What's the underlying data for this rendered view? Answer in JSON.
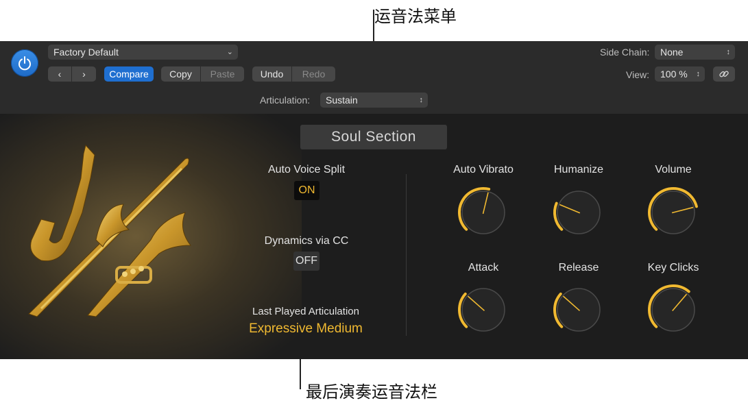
{
  "callouts": {
    "top": "运音法菜单",
    "bottom": "最后演奏运音法栏"
  },
  "header": {
    "preset": "Factory Default",
    "compare": "Compare",
    "copy": "Copy",
    "paste": "Paste",
    "undo": "Undo",
    "redo": "Redo",
    "articulation_label": "Articulation:",
    "articulation_value": "Sustain",
    "side_chain_label": "Side Chain:",
    "side_chain_value": "None",
    "view_label": "View:",
    "view_value": "100 %"
  },
  "plugin": {
    "title": "Soul Section",
    "auto_voice_split": {
      "label": "Auto Voice Split",
      "value": "ON"
    },
    "dynamics_via_cc": {
      "label": "Dynamics via CC",
      "value": "OFF"
    },
    "last_played": {
      "label": "Last Played Articulation",
      "value": "Expressive Medium"
    },
    "knobs": [
      {
        "label": "Auto Vibrato",
        "value": 0.55
      },
      {
        "label": "Humanize",
        "value": 0.25
      },
      {
        "label": "Volume",
        "value": 0.78
      },
      {
        "label": "Attack",
        "value": 0.32
      },
      {
        "label": "Release",
        "value": 0.32
      },
      {
        "label": "Key Clicks",
        "value": 0.65
      }
    ]
  },
  "colors": {
    "accent": "#f0b931",
    "blue": "#1f6fd0",
    "panel": "#1d1d1d",
    "header": "#2b2b2b"
  }
}
